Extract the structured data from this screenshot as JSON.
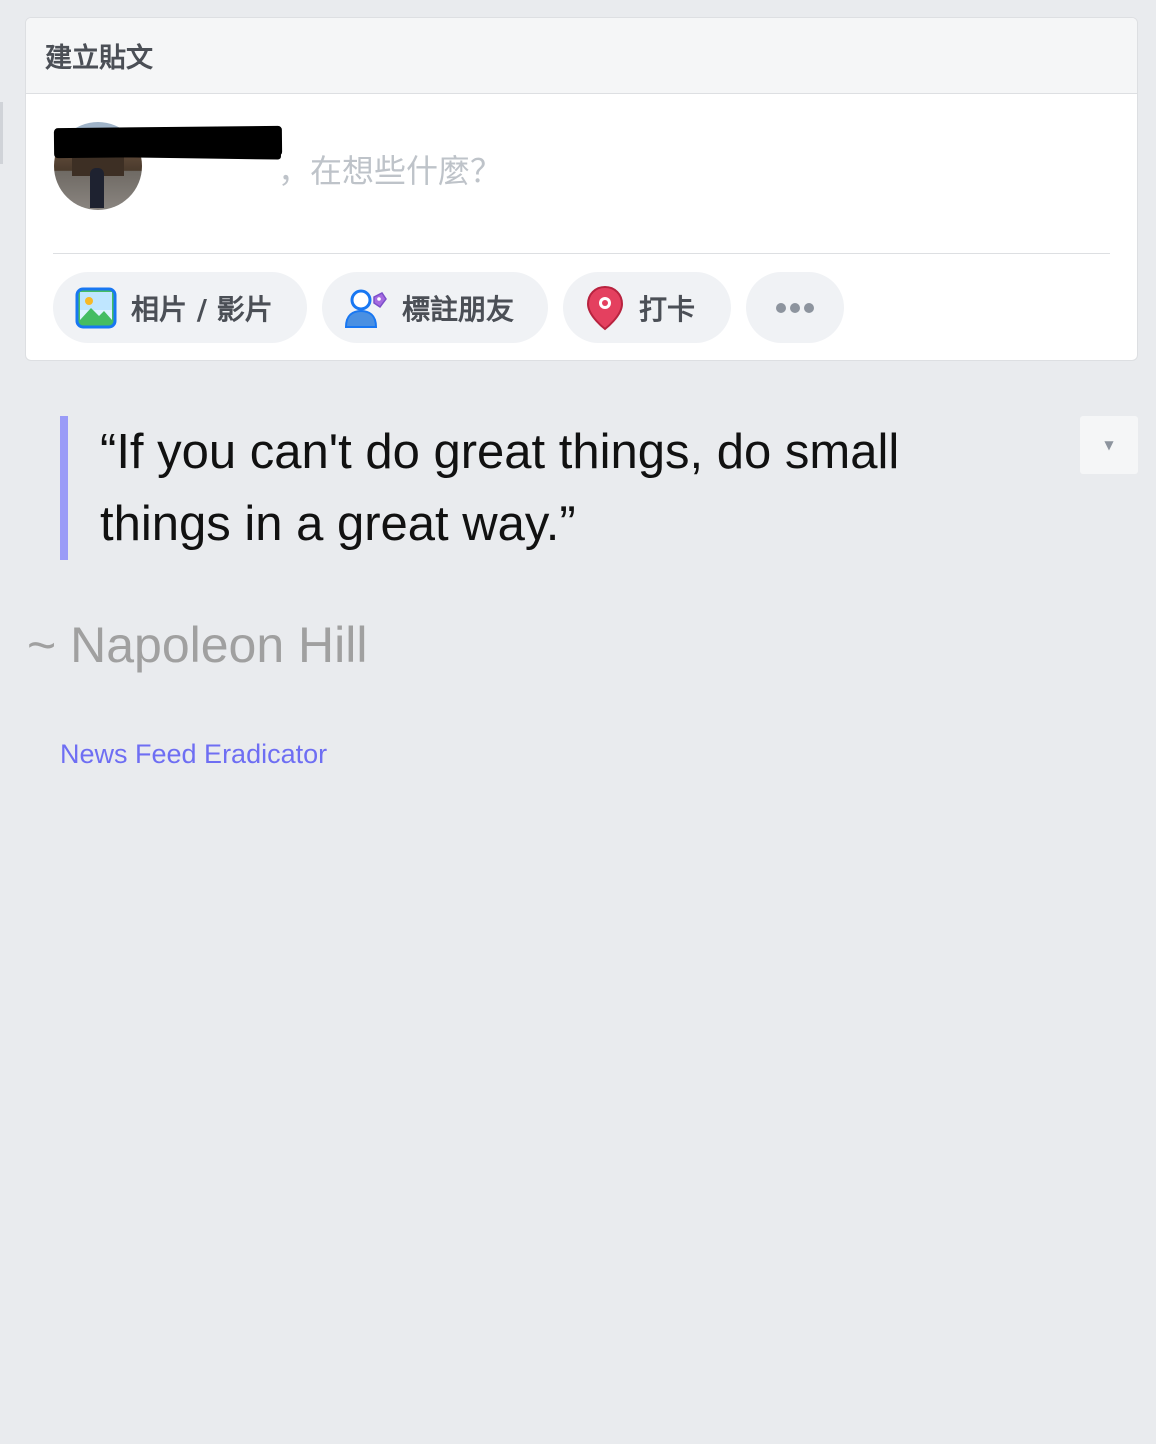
{
  "composer": {
    "title": "建立貼文",
    "prompt": "，在想些什麼？",
    "actions": [
      {
        "label": "相片 / 影片",
        "icon": "photo-icon"
      },
      {
        "label": "標註朋友",
        "icon": "tag-friends-icon"
      },
      {
        "label": "打卡",
        "icon": "location-pin-icon"
      },
      {
        "label": "",
        "icon": "more-dots-icon"
      }
    ]
  },
  "quote": {
    "text": "“If you can't do great things, do small things in a great way.”",
    "author": "~ Napoleon Hill"
  },
  "credit": {
    "label": "News Feed Eradicator"
  },
  "colors": {
    "background": "#e9ebee",
    "quote_bar": "#9a9bf7",
    "credit_link": "#6e6ef3",
    "checkin_pin": "#e4405f"
  }
}
